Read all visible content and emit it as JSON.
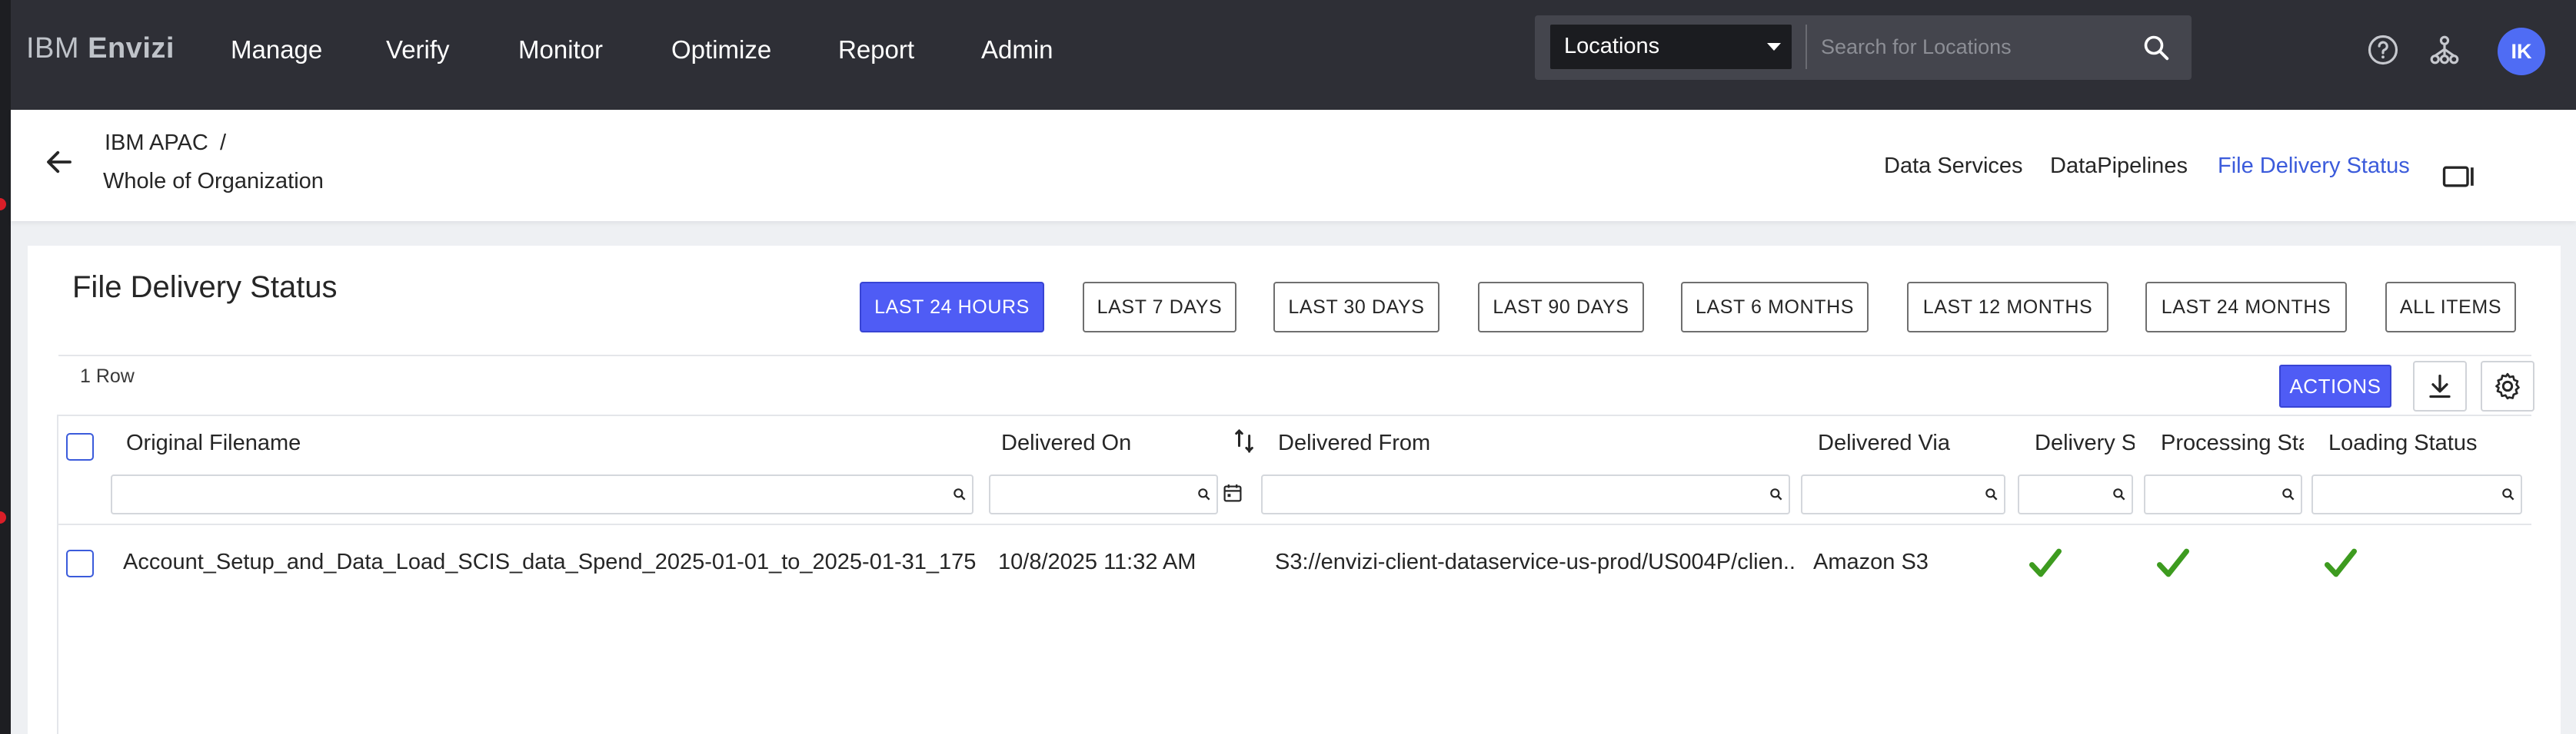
{
  "brand": {
    "prefix": "IBM",
    "name": "Envizi"
  },
  "nav": {
    "items": [
      "Manage",
      "Verify",
      "Monitor",
      "Optimize",
      "Report",
      "Admin"
    ]
  },
  "search": {
    "location_select": "Locations",
    "placeholder": "Search for Locations"
  },
  "user": {
    "initials": "IK"
  },
  "icons": {
    "help": "help-icon",
    "hierarchy": "hierarchy-icon",
    "search": "search-icon",
    "back": "arrow-left-icon",
    "panel": "panel-icon",
    "download": "download-icon",
    "settings": "gear-icon",
    "status_ok": "checkmark-icon"
  },
  "breadcrumb": {
    "parent": "IBM APAC",
    "separator": "/",
    "current": "Whole of Organization"
  },
  "subnav": {
    "links": [
      "Data Services",
      "DataPipelines",
      "File Delivery Status"
    ],
    "active": "File Delivery Status"
  },
  "page": {
    "title": "File Delivery Status"
  },
  "time_ranges": {
    "items": [
      "LAST 24 HOURS",
      "LAST 7 DAYS",
      "LAST 30 DAYS",
      "LAST 90 DAYS",
      "LAST 6 MONTHS",
      "LAST 12 MONTHS",
      "LAST 24 MONTHS",
      "ALL ITEMS"
    ],
    "active": "LAST 24 HOURS"
  },
  "grid": {
    "row_count": "1 Row",
    "actions_label": "ACTIONS",
    "columns": [
      "Original Filename",
      "Delivered On",
      "Delivered From",
      "Delivered Via",
      "Delivery S",
      "Processing Sta",
      "Loading Status"
    ],
    "rows": [
      {
        "filename": "Account_Setup_and_Data_Load_SCIS_data_Spend_2025-01-01_to_2025-01-31_175...",
        "delivered_on": "10/8/2025 11:32 AM",
        "delivered_from": "S3://envizi-client-dataservice-us-prod/US004P/clien...",
        "delivered_via": "Amazon S3",
        "delivery_status": "ok",
        "processing_status": "ok",
        "loading_status": "ok"
      }
    ]
  },
  "colors": {
    "accent": "#4f5cf5",
    "nav_bg": "#2e2f36",
    "link_active": "#3b5bdb",
    "success": "#3d9b1f"
  }
}
